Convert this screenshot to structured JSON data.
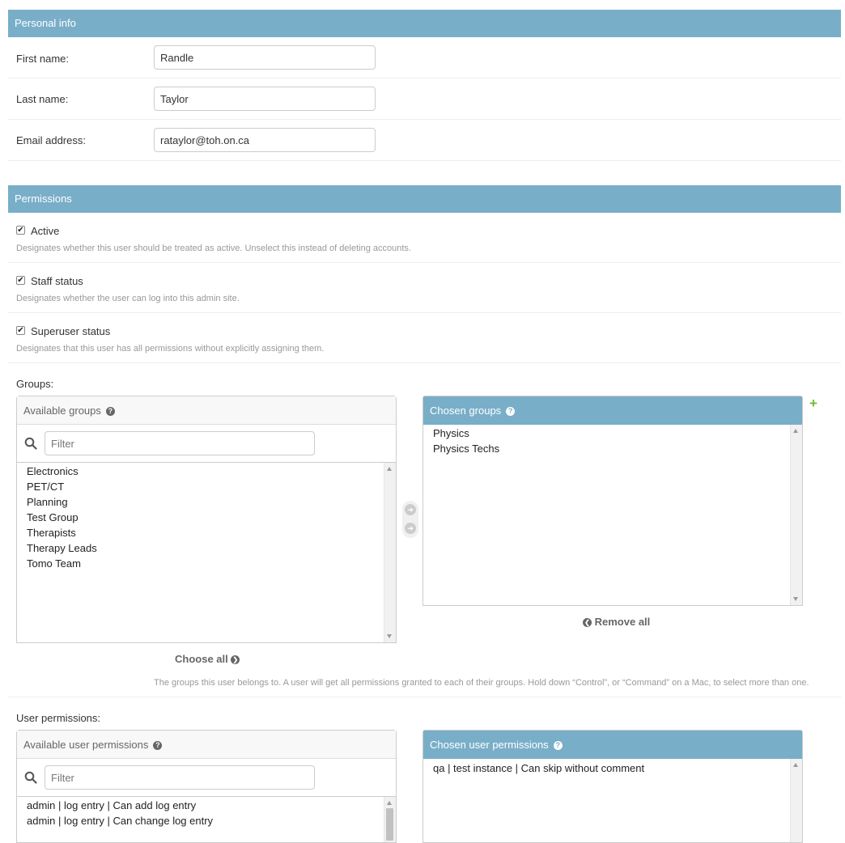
{
  "personal": {
    "heading": "Personal info",
    "first_name_label": "First name:",
    "first_name": "Randle",
    "last_name_label": "Last name:",
    "last_name": "Taylor",
    "email_label": "Email address:",
    "email": "rataylor@toh.on.ca"
  },
  "permissions": {
    "heading": "Permissions",
    "active": {
      "label": "Active",
      "checked": true,
      "help": "Designates whether this user should be treated as active. Unselect this instead of deleting accounts."
    },
    "staff": {
      "label": "Staff status",
      "checked": true,
      "help": "Designates whether the user can log into this admin site."
    },
    "superuser": {
      "label": "Superuser status",
      "checked": true,
      "help": "Designates that this user has all permissions without explicitly assigning them."
    }
  },
  "groups": {
    "label": "Groups:",
    "available_title": "Available groups",
    "filter_placeholder": "Filter",
    "available": [
      "Electronics",
      "PET/CT",
      "Planning",
      "Test Group",
      "Therapists",
      "Therapy Leads",
      "Tomo Team"
    ],
    "chosen_title": "Chosen groups",
    "chosen": [
      "Physics",
      "Physics Techs"
    ],
    "choose_all": "Choose all",
    "remove_all": "Remove all",
    "help": "The groups this user belongs to. A user will get all permissions granted to each of their groups. Hold down “Control”, or “Command” on a Mac, to select more than one."
  },
  "user_permissions": {
    "label": "User permissions:",
    "available_title": "Available user permissions",
    "filter_placeholder": "Filter",
    "available": [
      "admin | log entry | Can add log entry",
      "admin | log entry | Can change log entry"
    ],
    "chosen_title": "Chosen user permissions",
    "chosen": [
      "qa | test instance | Can skip without comment"
    ]
  },
  "icons": {
    "help": "question-circle-icon",
    "search": "magnifier-icon",
    "add": "plus-icon",
    "choose": "arrow-right-circle-icon",
    "remove": "arrow-left-circle-icon"
  },
  "colors": {
    "header": "#79aec8",
    "add": "#70bf2b"
  }
}
